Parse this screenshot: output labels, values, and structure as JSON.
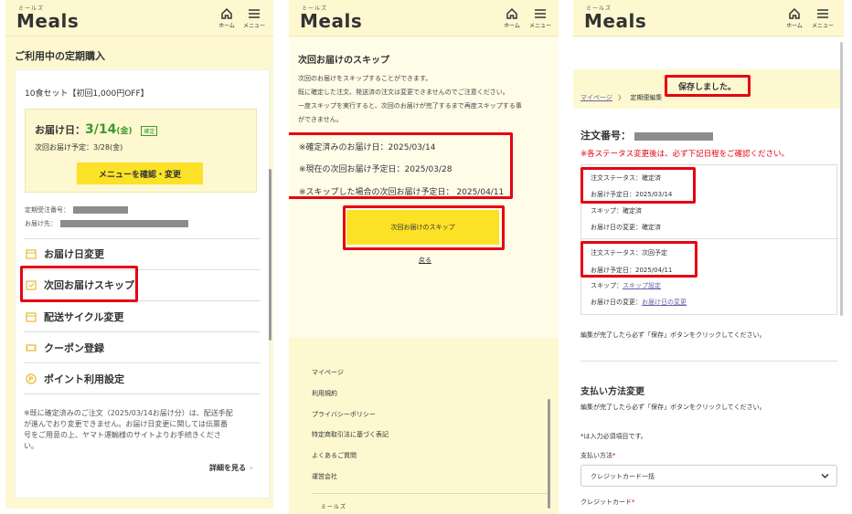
{
  "header": {
    "logo_kana": "ミールズ",
    "logo": "Meals",
    "home_label": "ホーム",
    "menu_label": "メニュー"
  },
  "panel1": {
    "title": "ご利用中の定期購入",
    "plan_name": "10食セット【初回1,000円OFF】",
    "delivery_label": "お届け日：",
    "delivery_date": "3/14",
    "delivery_day": "(金)",
    "confirmed_badge": "確定",
    "next_delivery": "次回お届け予定：3/28(金)",
    "confirm_menu_button": "メニューを確認・変更",
    "order_number_label": "定期受注番号：",
    "address_label": "お届け先：",
    "menu_items": [
      "お届け日変更",
      "次回お届けスキップ",
      "配送サイクル変更",
      "クーポン登録",
      "ポイント利用設定"
    ],
    "note": "※既に確定済みのご注文（2025/03/14お届け分）は、配送手配が進んでおり変更できません。お届け日変更に関しては伝票番号をご用意の上、ヤマト運輸様のサイトよりお手続きください。",
    "note_lines": [
      "※既に確定済みのご注文（2025/03/14お届け分）は、配送手配",
      "が進んでおり変更できません。お届け日変更に関しては伝票番",
      "号をご用意の上、ヤマト運輸様のサイトよりお手続きくださ",
      "い。"
    ],
    "details_link": "詳細を見る"
  },
  "panel2": {
    "title": "次回お届けのスキップ",
    "desc_lines": [
      "次回のお届けをスキップすることができます。",
      "既に確定した注文、発送済の注文は変更できませんのでご注意ください。",
      "一度スキップを実行すると、次回のお届けが完了するまで再度スキップする事",
      "ができません。"
    ],
    "info_lines": [
      "※確定済みのお届け日：2025/03/14",
      "※現在の次回お届け予定日：2025/03/28",
      "※スキップした場合の次回お届け予定日：  2025/04/11"
    ],
    "skip_button": "次回お届けのスキップ",
    "back_link": "戻る",
    "footer_links": [
      "マイページ",
      "利用規約",
      "プライバシーポリシー",
      "特定商取引法に基づく表記",
      "よくあるご質問",
      "運営会社"
    ],
    "footer_logo_kana": "ミールズ"
  },
  "panel3": {
    "saved_message": "保存しました。",
    "breadcrumb_mypage": "マイページ",
    "breadcrumb_sep": "〉",
    "breadcrumb_current": "定期便編集",
    "order_label": "注文番号：",
    "status_warning": "※各ステータス変更後は、必ず下記日程をご確認ください。",
    "block1": {
      "status": "注文ステータス：確定済",
      "date": "お届け予定日：2025/03/14",
      "skip": "スキップ：確定済",
      "change": "お届け日の変更：確定済"
    },
    "block2": {
      "status": "注文ステータス：次回予定",
      "date": "お届け予定日：2025/04/11",
      "skip_label": "スキップ：",
      "skip_link": "スキップ設定",
      "change_label": "お届け日の変更：",
      "change_link": "お届け日の変更"
    },
    "save_note": "編集が完了したら必ず「保存」ボタンをクリックしてください。",
    "payment_title": "支払い方法変更",
    "payment_note": "編集が完了したら必ず「保存」ボタンをクリックしてください。",
    "required_note": "*は入力必須項目です。",
    "payment_method_label": "支払い方法",
    "required_mark": "*",
    "payment_method_value": "クレジットカード一括",
    "credit_card_label": "クレジットカード"
  },
  "colors": {
    "header_bg": "#fdf8d0",
    "accent_yellow": "#fbe226",
    "highlight_red": "#e60012",
    "date_green": "#3d9a2e"
  }
}
